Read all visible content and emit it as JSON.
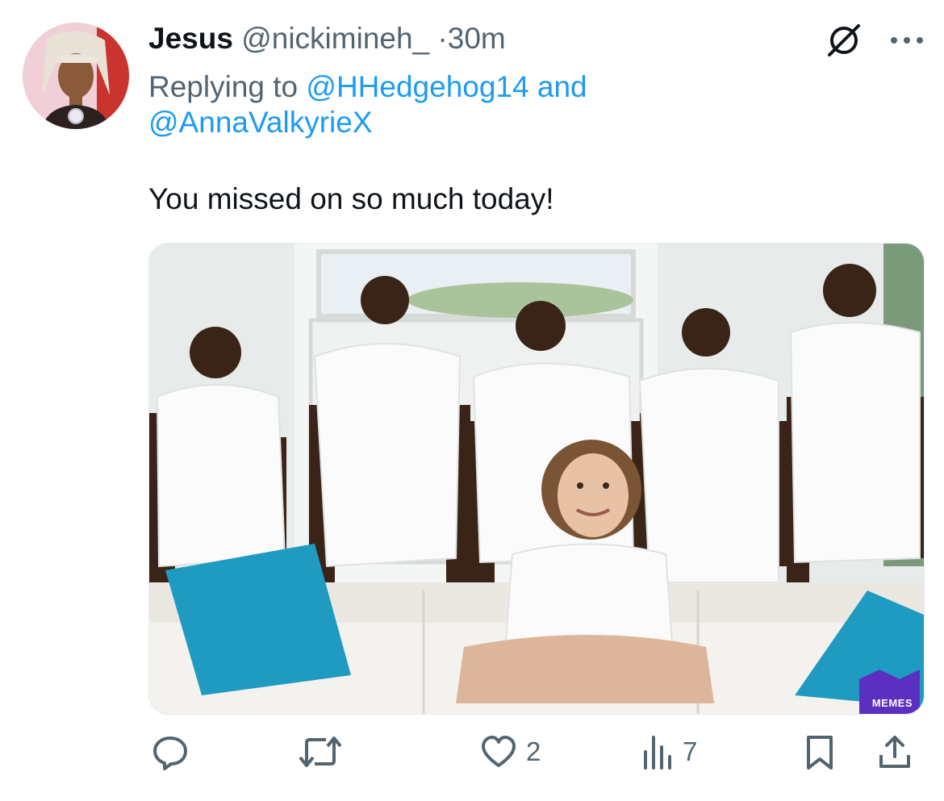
{
  "tweet": {
    "display_name": "Jesus",
    "handle": "@nickimineh_",
    "separator": "·",
    "time": "30m",
    "replying_prefix": "Replying to",
    "reply_to_1": "@HHedgehog14",
    "reply_and": "and",
    "reply_to_2": "@AnnaValkyrieX",
    "text": "You missed on so much today!"
  },
  "media": {
    "watermark": "MEMES"
  },
  "actions": {
    "reply_icon": "speech-bubble-icon",
    "retweet_icon": "retweet-icon",
    "like_icon": "heart-icon",
    "like_count": "2",
    "views_icon": "bar-chart-icon",
    "views_count": "7",
    "bookmark_icon": "bookmark-icon",
    "share_icon": "share-icon"
  },
  "colors": {
    "link": "#1d9bf0",
    "secondary_text": "#536471",
    "pillow": "#1f9bc1"
  }
}
